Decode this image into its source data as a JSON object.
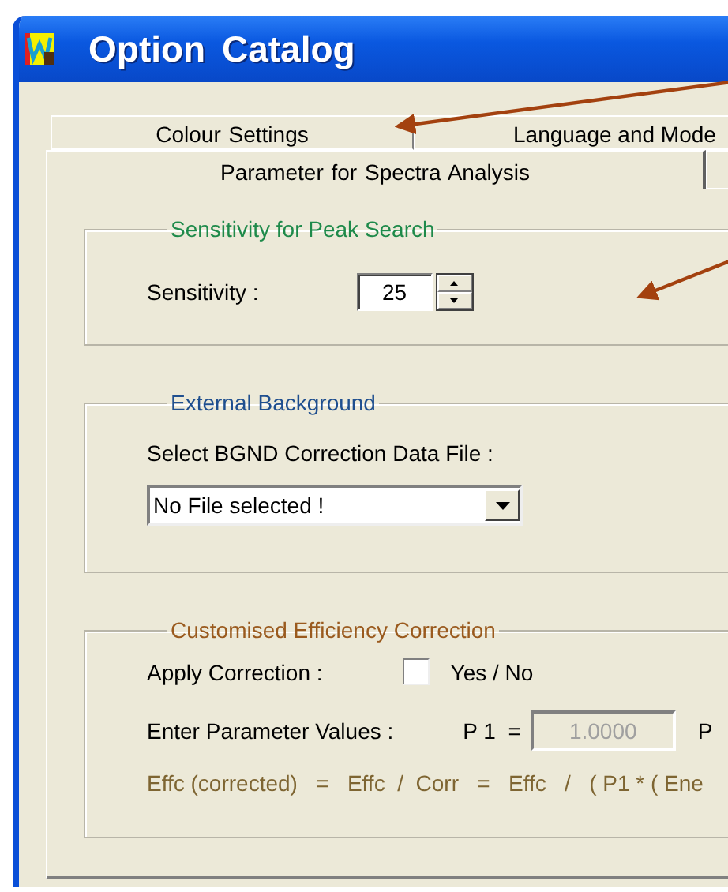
{
  "window": {
    "title": "Option Catalog"
  },
  "tab_rows": [
    [
      {
        "label": "Colour Settings",
        "selected": false
      },
      {
        "label": "Language and Mode",
        "selected": false
      }
    ],
    [
      {
        "label": "Parameter for Spectra Analysis",
        "selected": true
      },
      {
        "selected": false
      }
    ]
  ],
  "groups": [
    {
      "title": "Sensitivity for Peak Search",
      "color": "#1e8a4a",
      "kind": "spinner",
      "label": "Sensitivity :",
      "value": "25"
    },
    {
      "title": "External Background",
      "color": "#1f4f8f",
      "kind": "dropdown",
      "label": "Select  BGND  Correction  Data  File  :",
      "value": "No File selected !"
    },
    {
      "title": "Customised  Efficiency  Correction",
      "color": "#9a5a1e",
      "kind": "correction",
      "checkbox": {
        "label": "Apply Correction :",
        "option": "Yes / No",
        "checked": false
      },
      "params": {
        "label": "Enter Parameter Values :",
        "fields": [
          {
            "name": "P 1  =",
            "value": "1.0000",
            "disabled": true
          },
          {
            "name": "P"
          }
        ]
      },
      "formula": "Effc (corrected)   =   Effc  /  Corr   =   Effc   /   ( P1 * ( Ene"
    }
  ],
  "annotations": [
    {
      "kind": "arrow"
    },
    {
      "kind": "arrow"
    }
  ]
}
